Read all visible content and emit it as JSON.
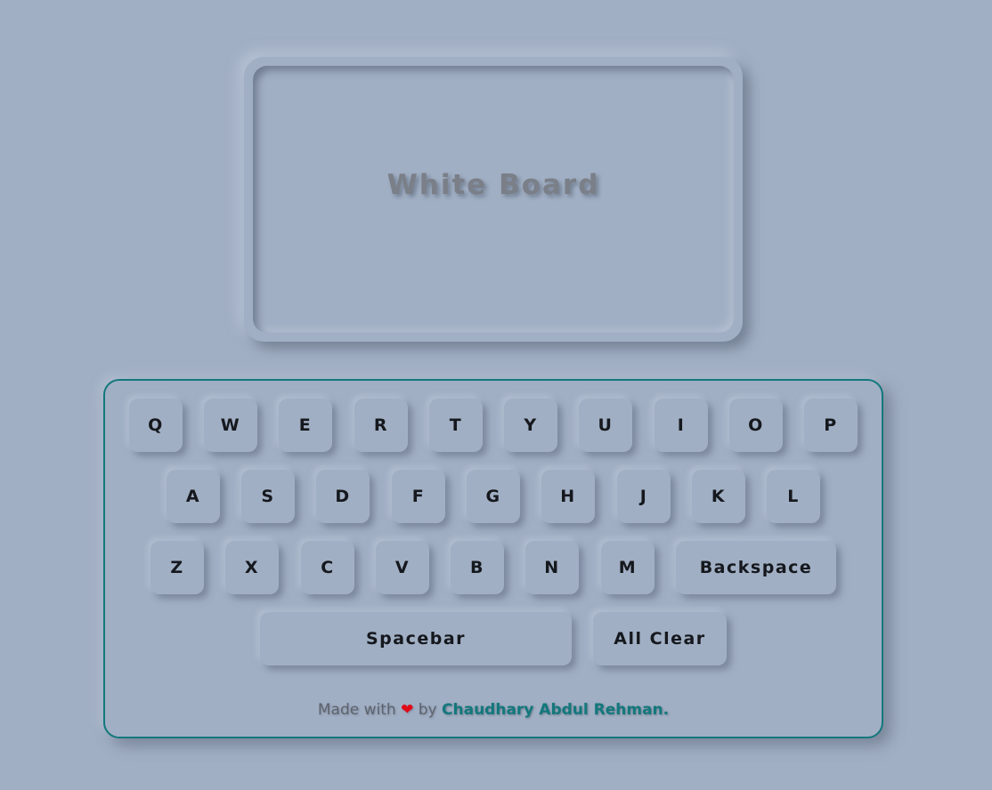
{
  "board": {
    "title": "White Board"
  },
  "keyboard": {
    "row1": [
      "Q",
      "W",
      "E",
      "R",
      "T",
      "Y",
      "U",
      "I",
      "O",
      "P"
    ],
    "row2": [
      "A",
      "S",
      "D",
      "F",
      "G",
      "H",
      "J",
      "K",
      "L"
    ],
    "row3": [
      "Z",
      "X",
      "C",
      "V",
      "B",
      "N",
      "M"
    ],
    "backspace_label": "Backspace",
    "spacebar_label": "Spacebar",
    "clear_label": "All Clear"
  },
  "footer": {
    "made_with": "Made with",
    "heart_icon": "heart-icon",
    "heart_glyph": "❤",
    "by": "by",
    "author": "Chaudhary Abdul Rehman."
  },
  "colors": {
    "background": "#a1afc4",
    "accent": "#12787c",
    "heart": "#e10a16"
  }
}
